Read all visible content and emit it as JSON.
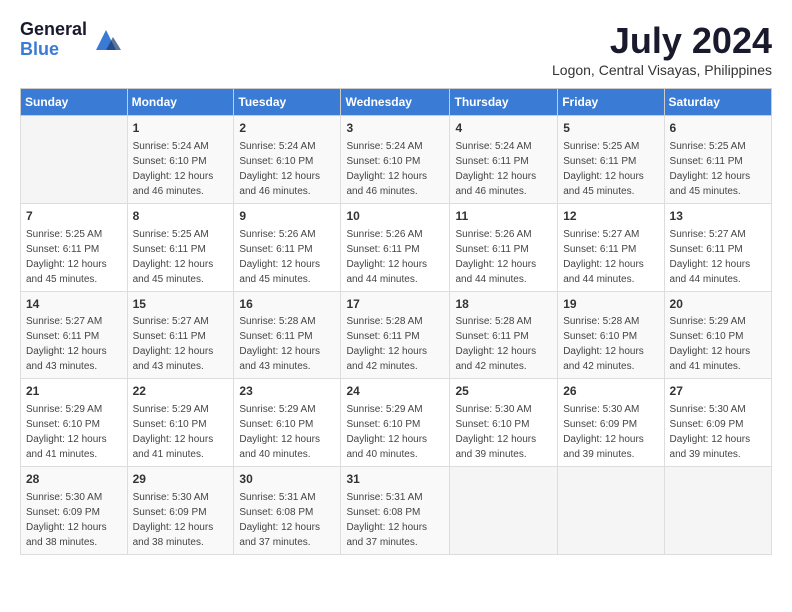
{
  "logo": {
    "general": "General",
    "blue": "Blue"
  },
  "title": "July 2024",
  "location": "Logon, Central Visayas, Philippines",
  "days_header": [
    "Sunday",
    "Monday",
    "Tuesday",
    "Wednesday",
    "Thursday",
    "Friday",
    "Saturday"
  ],
  "weeks": [
    [
      {
        "day": "",
        "info": ""
      },
      {
        "day": "1",
        "info": "Sunrise: 5:24 AM\nSunset: 6:10 PM\nDaylight: 12 hours\nand 46 minutes."
      },
      {
        "day": "2",
        "info": "Sunrise: 5:24 AM\nSunset: 6:10 PM\nDaylight: 12 hours\nand 46 minutes."
      },
      {
        "day": "3",
        "info": "Sunrise: 5:24 AM\nSunset: 6:10 PM\nDaylight: 12 hours\nand 46 minutes."
      },
      {
        "day": "4",
        "info": "Sunrise: 5:24 AM\nSunset: 6:11 PM\nDaylight: 12 hours\nand 46 minutes."
      },
      {
        "day": "5",
        "info": "Sunrise: 5:25 AM\nSunset: 6:11 PM\nDaylight: 12 hours\nand 45 minutes."
      },
      {
        "day": "6",
        "info": "Sunrise: 5:25 AM\nSunset: 6:11 PM\nDaylight: 12 hours\nand 45 minutes."
      }
    ],
    [
      {
        "day": "7",
        "info": "Sunrise: 5:25 AM\nSunset: 6:11 PM\nDaylight: 12 hours\nand 45 minutes."
      },
      {
        "day": "8",
        "info": "Sunrise: 5:25 AM\nSunset: 6:11 PM\nDaylight: 12 hours\nand 45 minutes."
      },
      {
        "day": "9",
        "info": "Sunrise: 5:26 AM\nSunset: 6:11 PM\nDaylight: 12 hours\nand 45 minutes."
      },
      {
        "day": "10",
        "info": "Sunrise: 5:26 AM\nSunset: 6:11 PM\nDaylight: 12 hours\nand 44 minutes."
      },
      {
        "day": "11",
        "info": "Sunrise: 5:26 AM\nSunset: 6:11 PM\nDaylight: 12 hours\nand 44 minutes."
      },
      {
        "day": "12",
        "info": "Sunrise: 5:27 AM\nSunset: 6:11 PM\nDaylight: 12 hours\nand 44 minutes."
      },
      {
        "day": "13",
        "info": "Sunrise: 5:27 AM\nSunset: 6:11 PM\nDaylight: 12 hours\nand 44 minutes."
      }
    ],
    [
      {
        "day": "14",
        "info": "Sunrise: 5:27 AM\nSunset: 6:11 PM\nDaylight: 12 hours\nand 43 minutes."
      },
      {
        "day": "15",
        "info": "Sunrise: 5:27 AM\nSunset: 6:11 PM\nDaylight: 12 hours\nand 43 minutes."
      },
      {
        "day": "16",
        "info": "Sunrise: 5:28 AM\nSunset: 6:11 PM\nDaylight: 12 hours\nand 43 minutes."
      },
      {
        "day": "17",
        "info": "Sunrise: 5:28 AM\nSunset: 6:11 PM\nDaylight: 12 hours\nand 42 minutes."
      },
      {
        "day": "18",
        "info": "Sunrise: 5:28 AM\nSunset: 6:11 PM\nDaylight: 12 hours\nand 42 minutes."
      },
      {
        "day": "19",
        "info": "Sunrise: 5:28 AM\nSunset: 6:10 PM\nDaylight: 12 hours\nand 42 minutes."
      },
      {
        "day": "20",
        "info": "Sunrise: 5:29 AM\nSunset: 6:10 PM\nDaylight: 12 hours\nand 41 minutes."
      }
    ],
    [
      {
        "day": "21",
        "info": "Sunrise: 5:29 AM\nSunset: 6:10 PM\nDaylight: 12 hours\nand 41 minutes."
      },
      {
        "day": "22",
        "info": "Sunrise: 5:29 AM\nSunset: 6:10 PM\nDaylight: 12 hours\nand 41 minutes."
      },
      {
        "day": "23",
        "info": "Sunrise: 5:29 AM\nSunset: 6:10 PM\nDaylight: 12 hours\nand 40 minutes."
      },
      {
        "day": "24",
        "info": "Sunrise: 5:29 AM\nSunset: 6:10 PM\nDaylight: 12 hours\nand 40 minutes."
      },
      {
        "day": "25",
        "info": "Sunrise: 5:30 AM\nSunset: 6:10 PM\nDaylight: 12 hours\nand 39 minutes."
      },
      {
        "day": "26",
        "info": "Sunrise: 5:30 AM\nSunset: 6:09 PM\nDaylight: 12 hours\nand 39 minutes."
      },
      {
        "day": "27",
        "info": "Sunrise: 5:30 AM\nSunset: 6:09 PM\nDaylight: 12 hours\nand 39 minutes."
      }
    ],
    [
      {
        "day": "28",
        "info": "Sunrise: 5:30 AM\nSunset: 6:09 PM\nDaylight: 12 hours\nand 38 minutes."
      },
      {
        "day": "29",
        "info": "Sunrise: 5:30 AM\nSunset: 6:09 PM\nDaylight: 12 hours\nand 38 minutes."
      },
      {
        "day": "30",
        "info": "Sunrise: 5:31 AM\nSunset: 6:08 PM\nDaylight: 12 hours\nand 37 minutes."
      },
      {
        "day": "31",
        "info": "Sunrise: 5:31 AM\nSunset: 6:08 PM\nDaylight: 12 hours\nand 37 minutes."
      },
      {
        "day": "",
        "info": ""
      },
      {
        "day": "",
        "info": ""
      },
      {
        "day": "",
        "info": ""
      }
    ]
  ]
}
